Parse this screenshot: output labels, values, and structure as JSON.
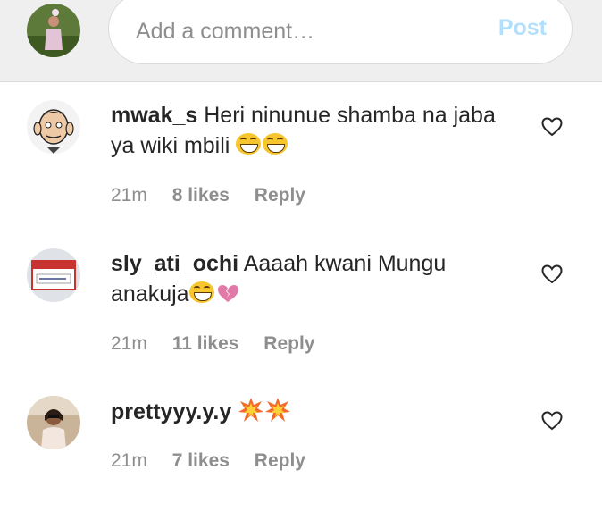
{
  "composer": {
    "placeholder": "Add a comment…",
    "post_label": "Post"
  },
  "comments": [
    {
      "username": "mwak_s",
      "text": "Heri ninunue shamba na jaba ya wiki mbili",
      "emoji": "😂😂",
      "time": "21m",
      "likes": "8 likes",
      "reply": "Reply"
    },
    {
      "username": "sly_ati_ochi",
      "text": "Aaaah kwani Mungu anakuja",
      "emoji": "😂💔",
      "time": "21m",
      "likes": "11 likes",
      "reply": "Reply"
    },
    {
      "username": "prettyyy.y.y",
      "text": "",
      "emoji": "💥💥",
      "time": "21m",
      "likes": "7 likes",
      "reply": "Reply"
    }
  ],
  "icons": {
    "like": "heart-outline-icon"
  },
  "colors": {
    "post_disabled": "#b2dffc",
    "meta_gray": "#8e8e8e",
    "text": "#262626"
  }
}
